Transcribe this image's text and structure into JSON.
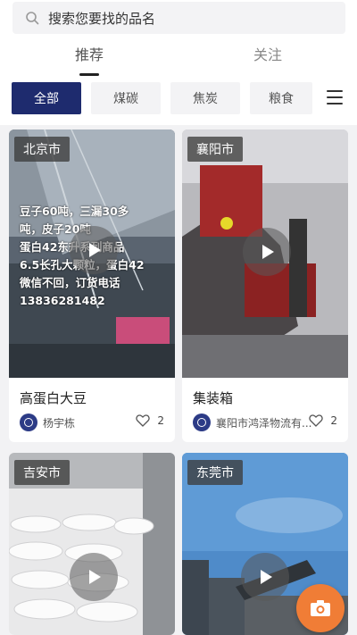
{
  "search": {
    "placeholder": "搜索您要找的品名"
  },
  "tabs": [
    {
      "label": "推荐",
      "active": true
    },
    {
      "label": "关注",
      "active": false
    }
  ],
  "categories": [
    {
      "label": "全部",
      "active": true
    },
    {
      "label": "煤碳"
    },
    {
      "label": "焦炭"
    },
    {
      "label": "粮食"
    }
  ],
  "colors": {
    "accent": "#1e2b6e",
    "camera": "#f07d36"
  },
  "cards": [
    {
      "city": "北京市",
      "overlay_lines": [
        "豆子60吨，三漏30多",
        "吨，皮子20吨",
        "蛋白42东升系列商品",
        "6.5长孔大颗粒，蛋白42",
        "微信不回，订货电话",
        "13836281482"
      ],
      "title": "高蛋白大豆",
      "author": "杨宇栋",
      "likes": "2"
    },
    {
      "city": "襄阳市",
      "title": "集装箱",
      "author": "襄阳市鸿泽物流有...",
      "likes": "2"
    },
    {
      "city": "吉安市"
    },
    {
      "city": "东莞市"
    }
  ],
  "icons": {
    "search": "search-icon",
    "menu": "menu-icon",
    "play": "play-icon",
    "heart": "heart-icon",
    "camera": "camera-icon"
  }
}
